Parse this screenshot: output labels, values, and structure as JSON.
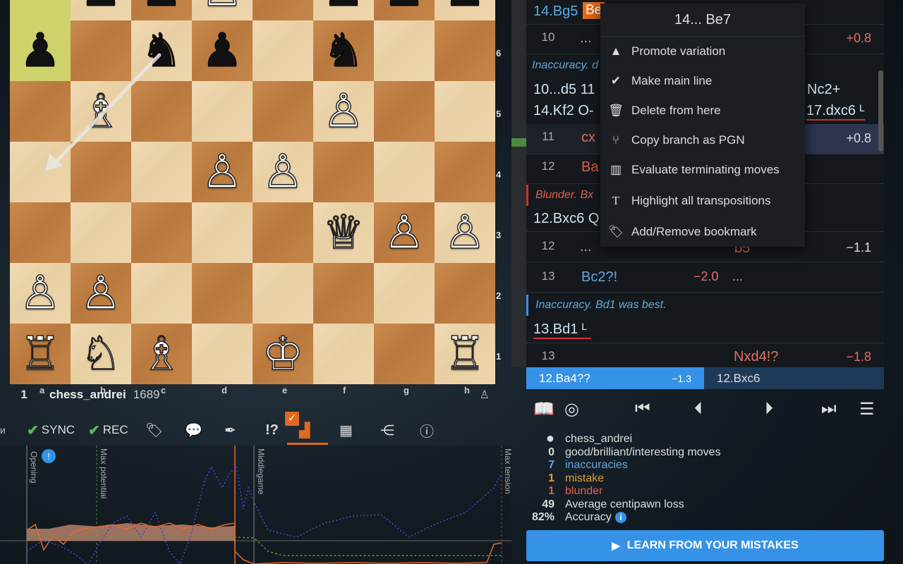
{
  "board": {
    "ranks": [
      "6",
      "5",
      "4",
      "3",
      "2",
      "1"
    ],
    "files": [
      "a",
      "b",
      "c",
      "d",
      "e",
      "f",
      "g",
      "h"
    ]
  },
  "player": {
    "number": "1",
    "name": "chess_andrei",
    "rating": "1689"
  },
  "toolbar": {
    "sync": "SYNC",
    "rec": "REC",
    "glyph": "!?"
  },
  "chart": {
    "phases": [
      "Opening",
      "Max potential",
      "Middlegame",
      "Max tension"
    ],
    "colors": {
      "advantage": "#b7806b",
      "eval": "#e26a2c",
      "tension": "#4b46c8",
      "material": "#3f9f2f"
    }
  },
  "moves": {
    "top_line": "14.Bg5",
    "top_line_tag": "Be",
    "row10_num": "10",
    "row10_dots": "...",
    "row10_eval": "+0.8",
    "comment1": "Inaccuracy. d",
    "line1": "10...d5 11",
    "line1_right": "Nc2+",
    "line2": "14.Kf2 O-",
    "line2_right": "17.dxc6 ᴸ",
    "row11_num": "11",
    "row11_move": "cx",
    "row11_eval": "+0.8",
    "row12_num": "12",
    "row12_move": "Ba",
    "comment2": "Blunder. Bx",
    "line3": "12.Bxc6 Q",
    "row12b_num": "12",
    "row12b_dots": "...",
    "row12b_move": "b5",
    "row12b_eval": "−1.1",
    "row13_num": "13",
    "row13_move": "Bc2?!",
    "row13_eval": "−2.0",
    "row13_dots": "...",
    "comment3": "Inaccuracy. Bd1 was best.",
    "line4": "13.Bd1 ᴸ",
    "row13b_num": "13",
    "row13b_move": "Nxd4!?",
    "row13b_eval": "−1.8"
  },
  "current": {
    "move_a": "12.Ba4??",
    "eval_a": "−1.3",
    "move_b": "12.Bxc6"
  },
  "stats": [
    {
      "value": "",
      "label": "chess_andrei",
      "color": "#e8e8e8"
    },
    {
      "value": "0",
      "label": "good/brilliant/interesting moves",
      "color": "#e8e8e8"
    },
    {
      "value": "7",
      "label": "inaccuracies",
      "color": "#5da9e0"
    },
    {
      "value": "1",
      "label": "mistake",
      "color": "#e0a030"
    },
    {
      "value": "1",
      "label": "blunder",
      "color": "#e0604a"
    },
    {
      "value": "49",
      "label": "Average centipawn loss",
      "color": "#e8e8e8"
    },
    {
      "value": "82%",
      "label": "Accuracy",
      "color": "#e8e8e8"
    }
  ],
  "learn_label": "LEARN FROM YOUR MISTAKES",
  "menu": {
    "title": "14... Be7",
    "items": [
      {
        "label": "Promote variation",
        "icon": "triangle-up-icon"
      },
      {
        "label": "Make main line",
        "icon": "check-icon"
      },
      {
        "label": "Delete from here",
        "icon": "trash-icon"
      },
      {
        "label": "Copy branch as PGN",
        "icon": "branch-icon"
      },
      {
        "label": "Evaluate terminating moves",
        "icon": "chart-icon"
      },
      {
        "label": "Highlight all transpositions",
        "icon": "text-icon"
      },
      {
        "label": "Add/Remove bookmark",
        "icon": "bookmark-icon"
      }
    ]
  }
}
